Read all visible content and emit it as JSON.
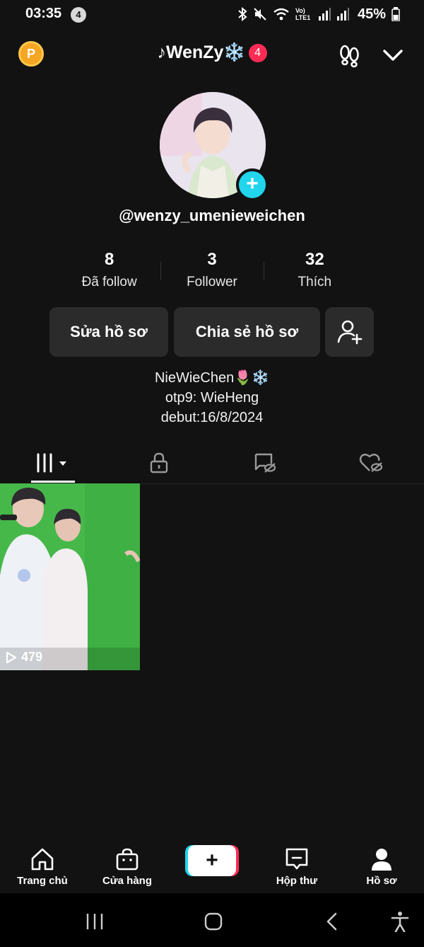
{
  "status_bar": {
    "time": "03:35",
    "notification_count": "4",
    "network_label": "Vo) LTE1",
    "battery": "45%"
  },
  "header": {
    "coin_letter": "P",
    "title": "♪WenZy❄️",
    "inbox_badge": "4"
  },
  "profile": {
    "handle": "@wenzy_umenieweichen",
    "add_icon": "+",
    "stats": [
      {
        "value": "8",
        "label": "Đã follow"
      },
      {
        "value": "3",
        "label": "Follower"
      },
      {
        "value": "32",
        "label": "Thích"
      }
    ],
    "edit_label": "Sửa hồ sơ",
    "share_label": "Chia sẻ hồ sơ",
    "bio": [
      "NieWieChen🌷❄️",
      "otp9: WieHeng",
      "debut:16/8/2024"
    ]
  },
  "tabs": [
    {
      "icon": "grid-icon",
      "active": true
    },
    {
      "icon": "lock-icon",
      "active": false
    },
    {
      "icon": "tag-hidden-icon",
      "active": false
    },
    {
      "icon": "liked-hidden-icon",
      "active": false
    }
  ],
  "videos": [
    {
      "views": "479"
    }
  ],
  "bottom_nav": {
    "home": "Trang chủ",
    "shop": "Cửa hàng",
    "create": "+",
    "inbox": "Hộp thư",
    "profile": "Hồ sơ"
  },
  "colors": {
    "background": "#121212",
    "accent_cyan": "#20d5ec",
    "accent_red": "#fe2c55",
    "button_bg": "#2b2b2b"
  }
}
